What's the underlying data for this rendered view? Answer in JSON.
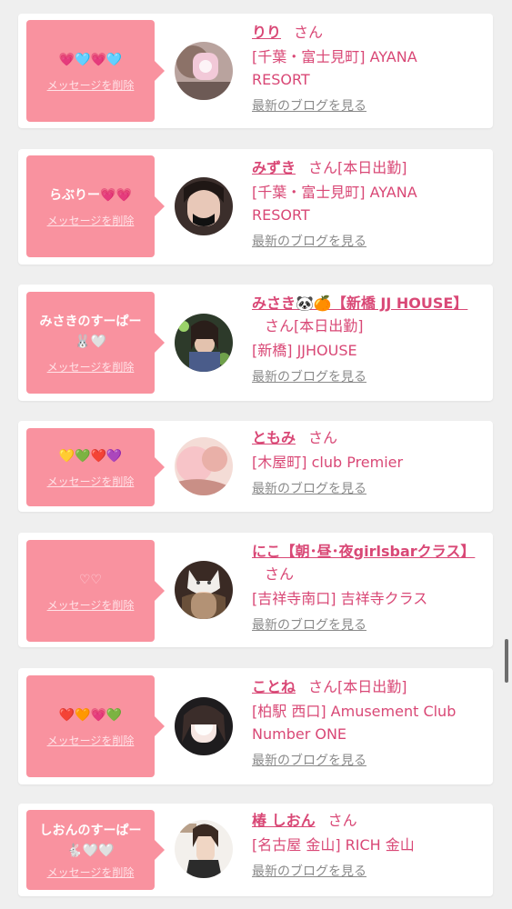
{
  "delete_label": "メッセージを削除",
  "san_label": "さん",
  "blog_label": "最新のブログを見る",
  "colors": {
    "bubble": "#f9929f",
    "accent": "#d94876",
    "link_gray": "#8a8a8a"
  },
  "cards": [
    {
      "message": "💗🩵💗🩵",
      "name": "りり",
      "status": "",
      "location": "[千葉・富士見町] AYANA RESORT",
      "avatar_icon": "girl-photo-avatar"
    },
    {
      "message": "らぶりー💗💗",
      "name": "みずき",
      "status": "[本日出勤]",
      "location": "[千葉・富士見町] AYANA RESORT",
      "avatar_icon": "girl-photo-avatar"
    },
    {
      "message": "みさきのすーぱー🐰🤍",
      "name": "みさき🐼🍊【新橋 JJ HOUSE】",
      "status": "[本日出勤]",
      "location": "[新橋] JJHOUSE",
      "avatar_icon": "girl-photo-avatar"
    },
    {
      "message": "💛💚❤️💜",
      "name": "ともみ",
      "status": "",
      "location": "[木屋町] club Premier",
      "avatar_icon": "girl-photo-avatar"
    },
    {
      "message": "♡♡",
      "name": "にこ【朝･昼･夜girlsbarクラス】",
      "status": "",
      "location": "[吉祥寺南口] 吉祥寺クラス",
      "avatar_icon": "cat-girl-avatar"
    },
    {
      "message": "❤️🧡💗💚",
      "name": "ことね",
      "status": "[本日出勤]",
      "location": "[柏駅 西口] Amusement Club Number ONE",
      "avatar_icon": "girl-photo-avatar"
    },
    {
      "message": "しおんのすーぱー🐇🤍🤍",
      "name": "椿 しおん",
      "status": "",
      "location": "[名古屋 金山] RICH 金山",
      "avatar_icon": "magazine-cover-avatar"
    }
  ]
}
